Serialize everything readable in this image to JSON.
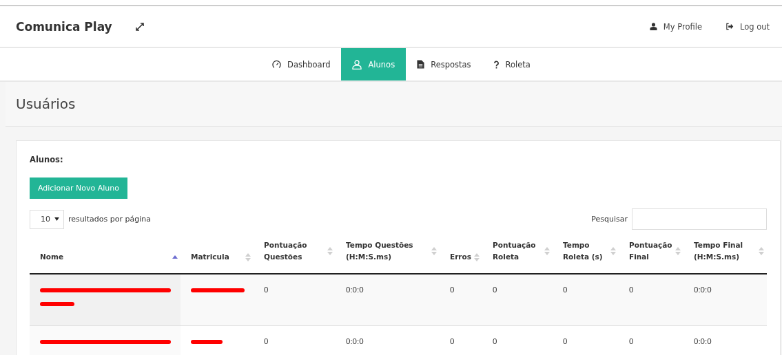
{
  "header": {
    "brand": "Comunica Play",
    "links": [
      {
        "label": "My Profile"
      },
      {
        "label": "Log out"
      }
    ]
  },
  "nav": [
    {
      "label": "Dashboard",
      "selected": false
    },
    {
      "label": "Alunos",
      "selected": true
    },
    {
      "label": "Respostas",
      "selected": false
    },
    {
      "label": "Roleta",
      "selected": false
    }
  ],
  "page_title": "Usuários",
  "card": {
    "title": "Alunos:",
    "add_button": "Adicionar Novo Aluno",
    "page_size": {
      "value": "10",
      "label": "resultados por página"
    },
    "search": {
      "label": "Pesquisar"
    }
  },
  "table": {
    "columns": [
      {
        "label": "Nome",
        "sorted": true
      },
      {
        "label": "Matricula",
        "sorted": false
      },
      {
        "label": "Pontuação Questões",
        "sorted": false
      },
      {
        "label": "Tempo Questões (H:M:S.ms)",
        "sorted": false
      },
      {
        "label": "Erros",
        "sorted": false
      },
      {
        "label": "Pontuação Roleta",
        "sorted": false
      },
      {
        "label": "Tempo Roleta (s)",
        "sorted": false
      },
      {
        "label": "Pontuação Final",
        "sorted": false
      },
      {
        "label": "Tempo Final (H:M:S.ms)",
        "sorted": false
      }
    ],
    "rows": [
      {
        "cells": [
          {
            "kind": "redacted_two_lines"
          },
          {
            "kind": "redacted"
          },
          {
            "kind": "text",
            "text": "0"
          },
          {
            "kind": "text",
            "text": "0:0:0"
          },
          {
            "kind": "text",
            "text": "0"
          },
          {
            "kind": "text",
            "text": "0"
          },
          {
            "kind": "text",
            "text": "0"
          },
          {
            "kind": "text",
            "text": "0"
          },
          {
            "kind": "text",
            "text": "0:0:0"
          }
        ]
      },
      {
        "cells": [
          {
            "kind": "redacted"
          },
          {
            "kind": "redacted"
          },
          {
            "kind": "text",
            "text": "0"
          },
          {
            "kind": "text",
            "text": "0:0:0"
          },
          {
            "kind": "text",
            "text": "0"
          },
          {
            "kind": "text",
            "text": "0"
          },
          {
            "kind": "text",
            "text": "0"
          },
          {
            "kind": "text",
            "text": "0"
          },
          {
            "kind": "text",
            "text": "0:0:0"
          }
        ]
      }
    ]
  }
}
